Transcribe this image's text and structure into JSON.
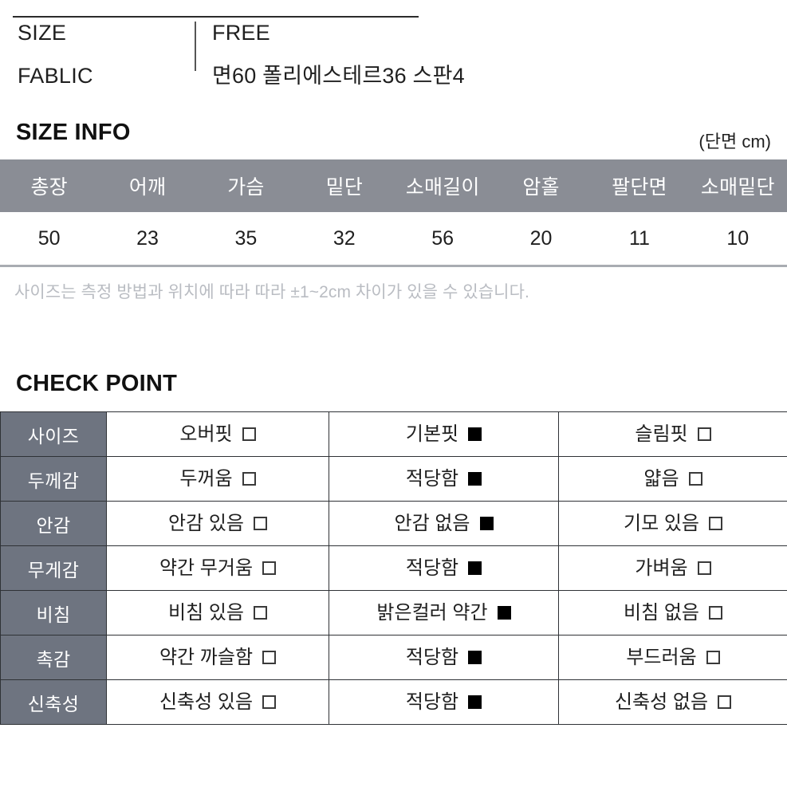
{
  "spec": {
    "rows": [
      {
        "label": "SIZE",
        "value": "FREE"
      },
      {
        "label": "FABLIC",
        "value": "면60 폴리에스테르36 스판4"
      }
    ]
  },
  "size_info": {
    "heading": "SIZE INFO",
    "unit": "(단면 cm)",
    "columns": [
      "총장",
      "어깨",
      "가슴",
      "밑단",
      "소매길이",
      "암홀",
      "팔단면",
      "소매밑단"
    ],
    "values": [
      "50",
      "23",
      "35",
      "32",
      "56",
      "20",
      "11",
      "10"
    ],
    "note": "사이즈는 측정 방법과 위치에 따라 따라 ±1~2cm 차이가 있을 수 있습니다.",
    "header_bg": "#8a8d95",
    "header_text_color": "#ffffff"
  },
  "check_point": {
    "heading": "CHECK POINT",
    "label_bg": "#6e7480",
    "rows": [
      {
        "label": "사이즈",
        "options": [
          {
            "text": "오버핏",
            "checked": false
          },
          {
            "text": "기본핏",
            "checked": true
          },
          {
            "text": "슬림핏",
            "checked": false
          }
        ]
      },
      {
        "label": "두께감",
        "options": [
          {
            "text": "두꺼움",
            "checked": false
          },
          {
            "text": "적당함",
            "checked": true
          },
          {
            "text": "얇음",
            "checked": false
          }
        ]
      },
      {
        "label": "안감",
        "options": [
          {
            "text": "안감 있음",
            "checked": false
          },
          {
            "text": "안감 없음",
            "checked": true
          },
          {
            "text": "기모 있음",
            "checked": false
          }
        ]
      },
      {
        "label": "무게감",
        "options": [
          {
            "text": "약간 무거움",
            "checked": false
          },
          {
            "text": "적당함",
            "checked": true
          },
          {
            "text": "가벼움",
            "checked": false
          }
        ]
      },
      {
        "label": "비침",
        "options": [
          {
            "text": "비침 있음",
            "checked": false
          },
          {
            "text": "밝은컬러 약간",
            "checked": true
          },
          {
            "text": "비침 없음",
            "checked": false
          }
        ]
      },
      {
        "label": "촉감",
        "options": [
          {
            "text": "약간 까슬함",
            "checked": false
          },
          {
            "text": "적당함",
            "checked": true
          },
          {
            "text": "부드러움",
            "checked": false
          }
        ]
      },
      {
        "label": "신축성",
        "options": [
          {
            "text": "신축성 있음",
            "checked": false
          },
          {
            "text": "적당함",
            "checked": true
          },
          {
            "text": "신축성 없음",
            "checked": false
          }
        ]
      }
    ]
  }
}
